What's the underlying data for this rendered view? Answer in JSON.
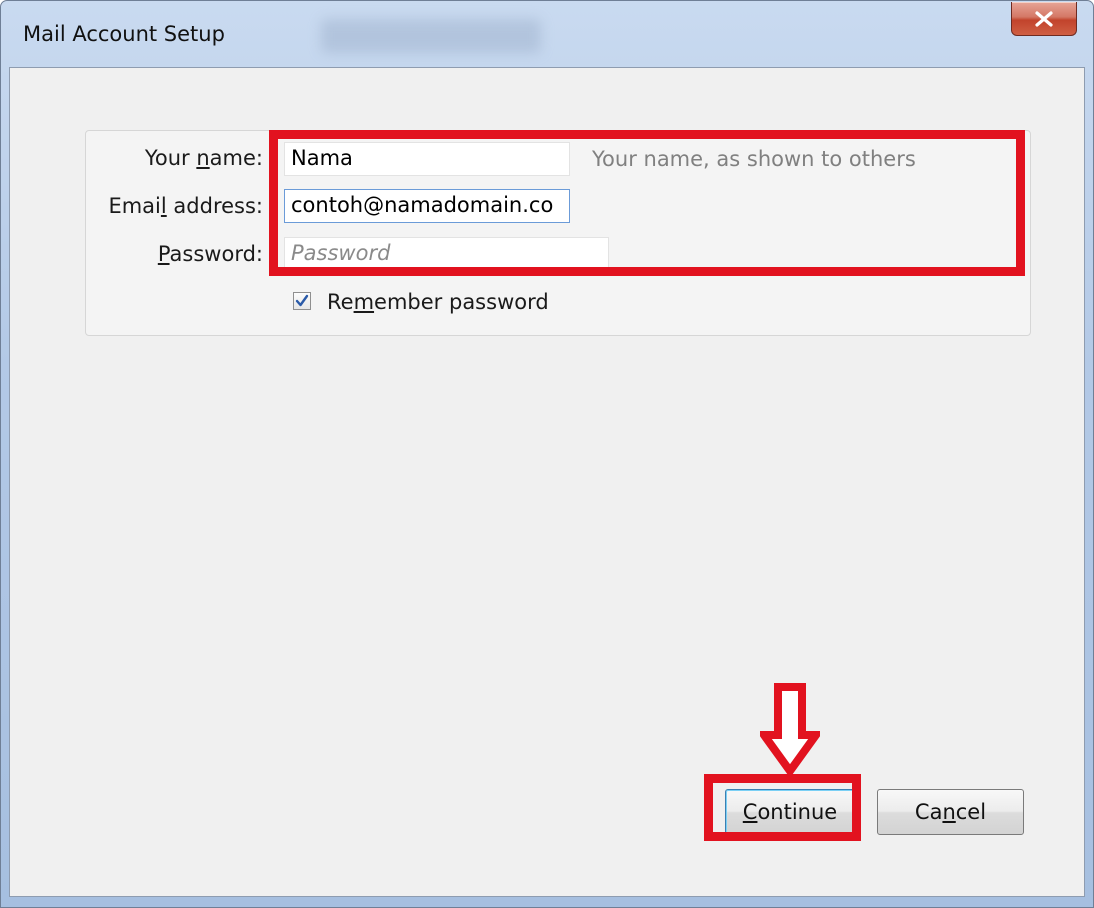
{
  "window": {
    "title": "Mail Account Setup",
    "close_icon": "close-icon"
  },
  "form": {
    "name": {
      "label_pre": "Your ",
      "label_key": "n",
      "label_post": "ame:",
      "value": "Nama",
      "hint": "Your name, as shown to others"
    },
    "email": {
      "label_pre": "Emai",
      "label_key": "l",
      "label_post": " address:",
      "value": "contoh@namadomain.co"
    },
    "password": {
      "label_pre": "",
      "label_key": "P",
      "label_post": "assword:",
      "placeholder": "Password"
    },
    "remember": {
      "checked": true,
      "label_pre": "Re",
      "label_key": "m",
      "label_post": "ember password"
    }
  },
  "buttons": {
    "continue": {
      "pre": "",
      "key": "C",
      "post": "ontinue"
    },
    "cancel": {
      "pre": "Ca",
      "key": "n",
      "post": "cel"
    }
  },
  "annotations": {
    "highlight_color": "#e2121f",
    "arrow_icon": "down-arrow-icon"
  }
}
